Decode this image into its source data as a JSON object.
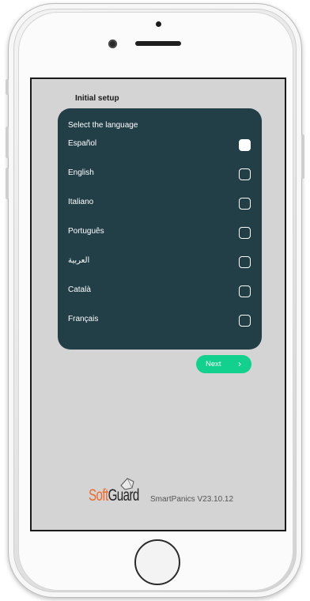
{
  "screen": {
    "title": "Initial setup",
    "panel_heading": "Select the language",
    "languages": [
      {
        "label": "Español",
        "checked": true
      },
      {
        "label": "English",
        "checked": false
      },
      {
        "label": "Italiano",
        "checked": false
      },
      {
        "label": "Português",
        "checked": false
      },
      {
        "label": "العربية",
        "checked": false
      },
      {
        "label": "Català",
        "checked": false
      },
      {
        "label": "Français",
        "checked": false
      }
    ],
    "next_label": "Next",
    "next_icon": "chevron-right-icon",
    "brand": {
      "soft": "Soft",
      "guard": "Guard"
    },
    "version": "SmartPanics V23.10.12"
  },
  "colors": {
    "panel": "#223f48",
    "accent": "#12d18e",
    "brand_orange": "#ee6a2b",
    "screen_bg": "#d4d4d4"
  }
}
